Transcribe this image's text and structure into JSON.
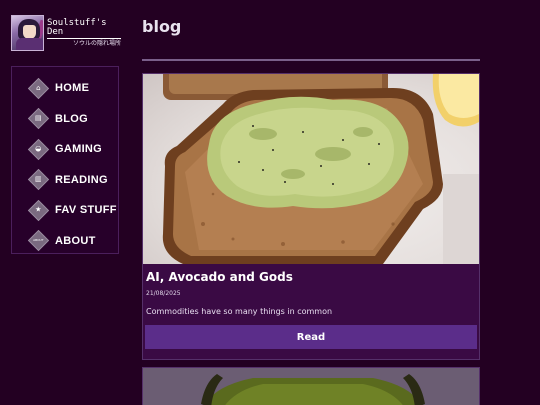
{
  "site": {
    "title": "Soulstuff's Den",
    "subtitle": "ソウルの隠れ場所"
  },
  "nav": {
    "items": [
      {
        "label": "HOME",
        "icon": "home-icon",
        "glyph": "⌂"
      },
      {
        "label": "BLOG",
        "icon": "document-icon",
        "glyph": "▤"
      },
      {
        "label": "GAMING",
        "icon": "gamepad-icon",
        "glyph": "◒"
      },
      {
        "label": "READING",
        "icon": "book-icon",
        "glyph": "▥"
      },
      {
        "label": "FAV STUFF",
        "icon": "star-icon",
        "glyph": "★"
      },
      {
        "label": "ABOUT",
        "icon": "about-icon",
        "glyph": "ABOUT"
      }
    ]
  },
  "page": {
    "title": "blog"
  },
  "posts": [
    {
      "title": "AI, Avocado and Gods",
      "date": "21/08/2025",
      "description": "Commodities have so many things in common",
      "read_label": "Read",
      "image": "avocado-toast-image"
    }
  ],
  "colors": {
    "background": "#230022",
    "nav_border": "#4b1f5c",
    "card_bg": "#3a0a44",
    "button": "#5b2d8a",
    "accent_rule": "#7a5f8a"
  }
}
